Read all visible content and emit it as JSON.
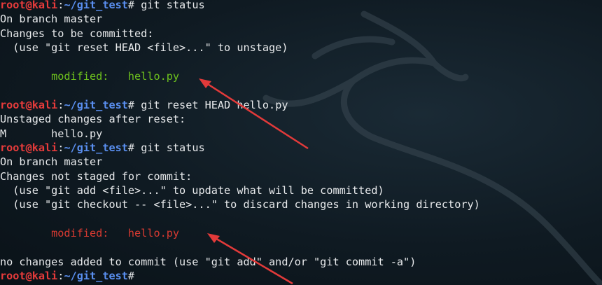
{
  "prompt": {
    "user": "root@kali",
    "sep": ":",
    "path": "~/git_test",
    "symbol": "# "
  },
  "commands": {
    "cmd1": "git status",
    "cmd2": "git reset HEAD hello.py",
    "cmd3": "git status"
  },
  "output": {
    "on_branch_1": "On branch master",
    "changes_committed": "Changes to be committed:",
    "hint_unstage": "  (use \"git reset HEAD <file>...\" to unstage)",
    "modified_staged": "        modified:   hello.py",
    "unstaged_after_reset": "Unstaged changes after reset:",
    "m_line": "M       hello.py",
    "on_branch_2": "On branch master",
    "changes_not_staged": "Changes not staged for commit:",
    "hint_add": "  (use \"git add <file>...\" to update what will be committed)",
    "hint_checkout": "  (use \"git checkout -- <file>...\" to discard changes in working directory)",
    "modified_unstaged": "        modified:   hello.py",
    "no_changes": "no changes added to commit (use \"git add\" and/or \"git commit -a\")"
  },
  "colors": {
    "prompt_user": "#e63b3b",
    "prompt_path": "#5a8ff0",
    "staged": "#6ec21d",
    "unstaged": "#d83a31",
    "annotation_arrow": "#e23a3a"
  }
}
